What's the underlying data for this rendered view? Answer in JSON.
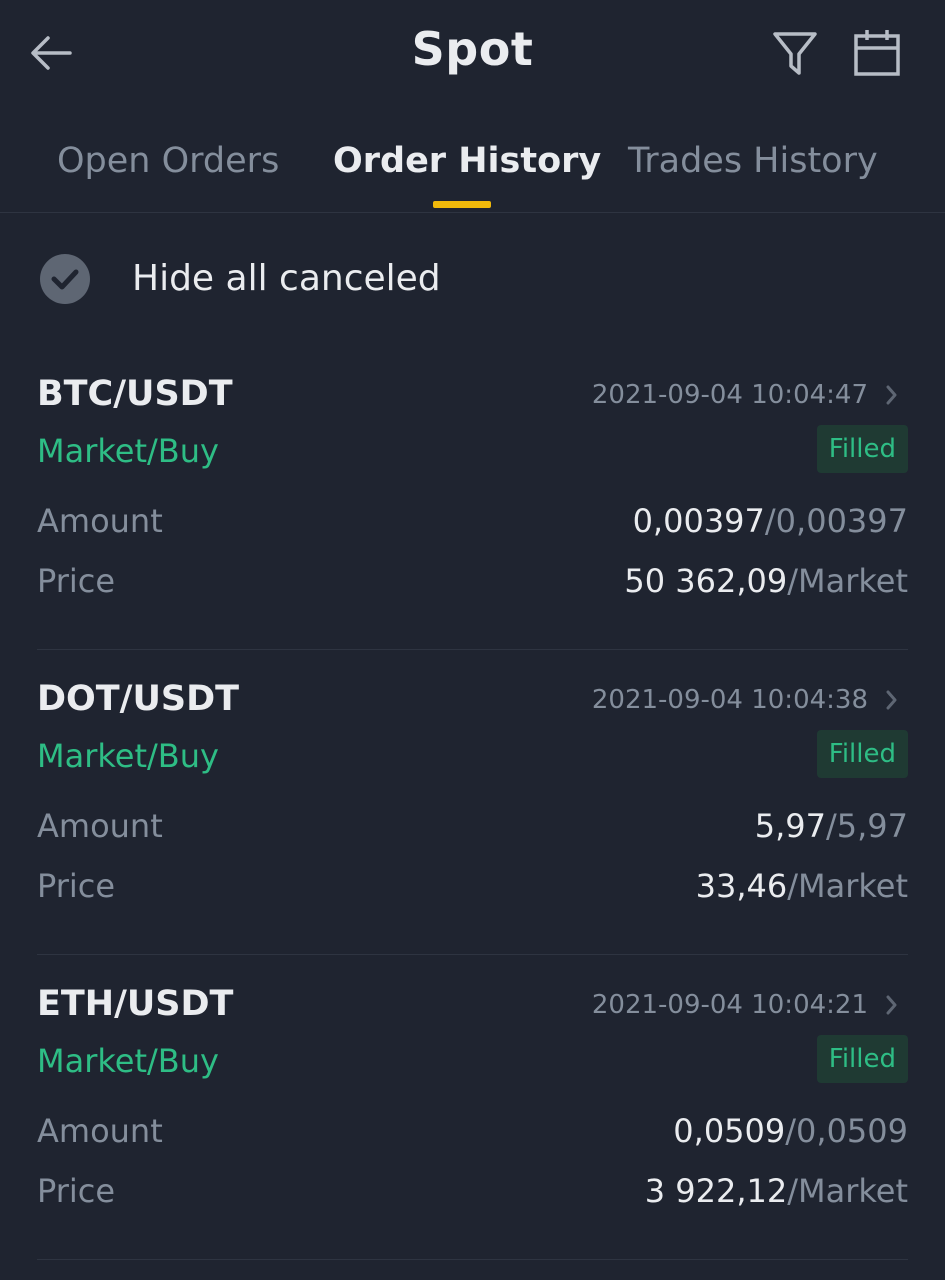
{
  "header": {
    "title": "Spot"
  },
  "icons": {
    "back": "arrow-left",
    "filter": "funnel",
    "calendar": "calendar"
  },
  "tabs": [
    {
      "label": "Open Orders",
      "active": false
    },
    {
      "label": "Order History",
      "active": true
    },
    {
      "label": "Trades History",
      "active": false
    }
  ],
  "filter": {
    "hide_canceled_label": "Hide all canceled",
    "hide_canceled_checked": true
  },
  "labels": {
    "amount": "Amount",
    "price": "Price"
  },
  "orders": [
    {
      "pair": "BTC/USDT",
      "datetime": "2021-09-04 10:04:47",
      "side": "Market/Buy",
      "status": "Filled",
      "amount_filled": "0,00397",
      "amount_total": "/0,00397",
      "price": "50 362,09",
      "price_type": "/Market"
    },
    {
      "pair": "DOT/USDT",
      "datetime": "2021-09-04 10:04:38",
      "side": "Market/Buy",
      "status": "Filled",
      "amount_filled": "5,97",
      "amount_total": "/5,97",
      "price": "33,46",
      "price_type": "/Market"
    },
    {
      "pair": "ETH/USDT",
      "datetime": "2021-09-04 10:04:21",
      "side": "Market/Buy",
      "status": "Filled",
      "amount_filled": "0,0509",
      "amount_total": "/0,0509",
      "price": "3 922,12",
      "price_type": "/Market"
    }
  ],
  "colors": {
    "background": "#1f2430",
    "accent": "#f0b90b",
    "buy_green": "#2ebd85",
    "muted": "#848e9c",
    "text": "#eaecef"
  }
}
